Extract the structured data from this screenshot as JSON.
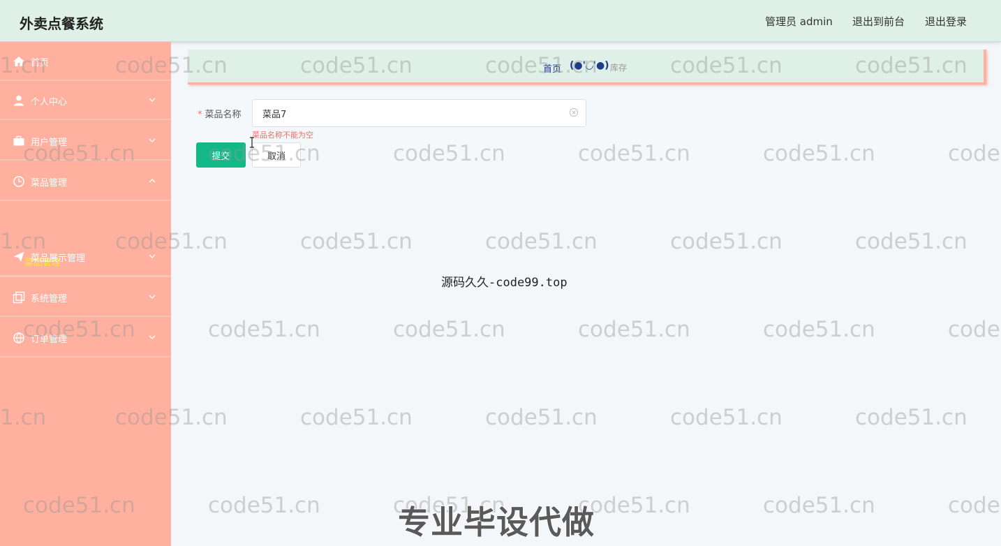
{
  "header": {
    "app_title": "外卖点餐系统",
    "admin_label": "管理员 admin",
    "front_link": "退出到前台",
    "logout_link": "退出登录"
  },
  "sidebar": {
    "items": [
      {
        "label": "首页",
        "icon": "home-icon"
      },
      {
        "label": "个人中心",
        "icon": "user-icon"
      },
      {
        "label": "用户管理",
        "icon": "briefcase-icon"
      },
      {
        "label": "菜品管理",
        "icon": "clock-icon"
      },
      {
        "label": "菜品展示管理",
        "icon": "send-icon"
      },
      {
        "label": "系统管理",
        "icon": "copy-icon"
      },
      {
        "label": "订单管理",
        "icon": "globe-icon"
      }
    ],
    "active_submenu": "菜品管理",
    "submenu_color": "#ffeb3b",
    "background_color": "#ffb09f"
  },
  "breadcrumb": {
    "home": "首页",
    "separator": "(●'◡'●)",
    "current": "库存"
  },
  "form": {
    "name_label": "菜品名称",
    "required_mark": "*",
    "name_value": "菜品7",
    "error_message": "菜品名称不能为空",
    "submit_label": "提交",
    "cancel_label": "取消",
    "submit_color": "#12b886"
  },
  "overlay": {
    "watermark": "code51.cn",
    "watermark_edge_left": "1.cn",
    "watermark_edge_right": "code",
    "caption": "源码久久-code99.top",
    "promo": "专业毕设代做"
  }
}
